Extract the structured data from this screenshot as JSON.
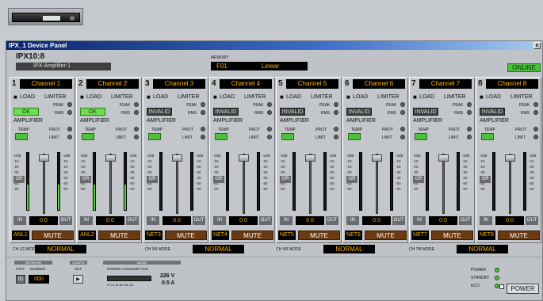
{
  "window": {
    "title": "IPX_1 Device Panel",
    "close_label": "x"
  },
  "header": {
    "model": "IPX10:8",
    "device_name": "IPX-Amplifier-1",
    "memory_label": "MEMORY",
    "memory_number": "F01",
    "memory_name": "Linear",
    "status": "ONLINE"
  },
  "labels": {
    "load": "LOAD",
    "limiter": "LIMITER",
    "peak": "PEAK",
    "rms": "RMS",
    "amplifier": "AMPLIFIER",
    "temp": "TEMP",
    "prot": "PROT",
    "limit": "LIMIT",
    "gr": "GR",
    "in": "IN",
    "out": "OUT",
    "mute": "MUTE",
    "scale_left": [
      "-0dB",
      "-10",
      "-20",
      "-30",
      "-40",
      "-50",
      "-60"
    ],
    "scale_right": [
      "-0dB",
      "-10",
      "-20",
      "-30",
      "-40",
      "-50",
      "-60"
    ]
  },
  "channels": [
    {
      "number": "1",
      "name": "Channel 1",
      "load_status": "OK",
      "gain": "0.0",
      "input": "ANL1",
      "meter_level": 0.45
    },
    {
      "number": "2",
      "name": "Channel 2",
      "load_status": "OK",
      "gain": "0.0",
      "input": "ANL2",
      "meter_level": 0.45
    },
    {
      "number": "3",
      "name": "Channel 3",
      "load_status": "INVALID",
      "gain": "0.0",
      "input": "NET3",
      "meter_level": 0.0
    },
    {
      "number": "4",
      "name": "Channel 4",
      "load_status": "INVALID",
      "gain": "0.0",
      "input": "NET4",
      "meter_level": 0.0
    },
    {
      "number": "5",
      "name": "Channel 5",
      "load_status": "INVALID",
      "gain": "0.0",
      "input": "NET5",
      "meter_level": 0.0
    },
    {
      "number": "6",
      "name": "Channel 6",
      "load_status": "INVALID",
      "gain": "0.0",
      "input": "NET6",
      "meter_level": 0.0
    },
    {
      "number": "7",
      "name": "Channel 7",
      "load_status": "INVALID",
      "gain": "0.0",
      "input": "NET7",
      "meter_level": 0.0
    },
    {
      "number": "8",
      "name": "Channel 8",
      "load_status": "INVALID",
      "gain": "0.0",
      "input": "NET8",
      "meter_level": 0.0
    }
  ],
  "modes": [
    {
      "label": "CH 1/2 MODE",
      "value": "NORMAL"
    },
    {
      "label": "CH 3/4 MODE",
      "value": "NORMAL"
    },
    {
      "label": "CH 5/6 MODE",
      "value": "NORMAL"
    },
    {
      "label": "CH 7/8 MODE",
      "value": "NORMAL"
    }
  ],
  "network": {
    "section": "NETWORK",
    "stat_label": "STAT",
    "number_label": "NUMBER",
    "id_label": "ID",
    "number": "000"
  },
  "config": {
    "section": "CONFIG",
    "set_label": "SET",
    "set_icon": "▶"
  },
  "mains": {
    "section": "MAINS",
    "consumption_label": "POWER CONSUMPTION",
    "scale": "0 0.3 1k 3k 10k 1A",
    "voltage": "226 V",
    "current": "0.5 A"
  },
  "power": {
    "power_label": "POWER",
    "standby_label": "STANDBY",
    "eco_label": "ECO",
    "button_label": "POWER"
  }
}
